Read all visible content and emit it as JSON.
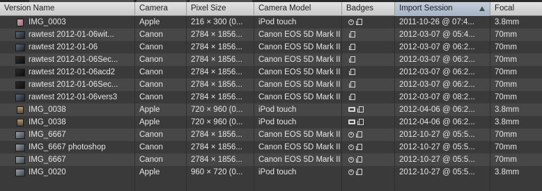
{
  "columns": [
    {
      "key": "name",
      "label": "Version Name"
    },
    {
      "key": "camera",
      "label": "Camera"
    },
    {
      "key": "pixel",
      "label": "Pixel Size"
    },
    {
      "key": "model",
      "label": "Camera Model"
    },
    {
      "key": "badges",
      "label": "Badges"
    },
    {
      "key": "session",
      "label": "Import Session",
      "sorted": "ascending"
    },
    {
      "key": "focal",
      "label": "Focal"
    }
  ],
  "rows": [
    {
      "name": "IMG_0003",
      "camera": "Apple",
      "pixel": "216 × 300 (0...",
      "model": "iPod touch",
      "badges": [
        "adjusted-icon",
        "stack-icon"
      ],
      "session": "2011-10-26 @ 07:4...",
      "focal": "3.8mm",
      "thumb": "pink"
    },
    {
      "name": "rawtest 2012-01-06wit...",
      "camera": "Canon",
      "pixel": "2784 × 1856...",
      "model": "Canon EOS 5D Mark II",
      "badges": [
        "stack-icon"
      ],
      "session": "2012-03-07 @ 05:4...",
      "focal": "70mm",
      "thumb": "dark"
    },
    {
      "name": "rawtest 2012-01-06",
      "camera": "Canon",
      "pixel": "2784 × 1856...",
      "model": "Canon EOS 5D Mark II",
      "badges": [
        "stack-icon"
      ],
      "session": "2012-03-07 @ 06:2...",
      "focal": "70mm",
      "thumb": "dark"
    },
    {
      "name": "rawtest 2012-01-06Sec...",
      "camera": "Canon",
      "pixel": "2784 × 1856...",
      "model": "Canon EOS 5D Mark II",
      "badges": [
        "stack-icon"
      ],
      "session": "2012-03-07 @ 06:2...",
      "focal": "70mm",
      "thumb": "dark2"
    },
    {
      "name": "rawtest 2012-01-06acd2",
      "camera": "Canon",
      "pixel": "2784 × 1856...",
      "model": "Canon EOS 5D Mark II",
      "badges": [
        "stack-icon"
      ],
      "session": "2012-03-07 @ 06:2...",
      "focal": "70mm",
      "thumb": "dark2"
    },
    {
      "name": "rawtest 2012-01-06Sec...",
      "camera": "Canon",
      "pixel": "2784 × 1856...",
      "model": "Canon EOS 5D Mark II",
      "badges": [
        "stack-icon"
      ],
      "session": "2012-03-07 @ 06:2...",
      "focal": "70mm",
      "thumb": "dark2"
    },
    {
      "name": "rawtest 2012-01-06vers3",
      "camera": "Canon",
      "pixel": "2784 × 1856...",
      "model": "Canon EOS 5D Mark II",
      "badges": [
        "stack-icon"
      ],
      "session": "2012-03-07 @ 08:2...",
      "focal": "70mm",
      "thumb": "dark"
    },
    {
      "name": "IMG_0038",
      "camera": "Apple",
      "pixel": "720 × 960 (0...",
      "model": "iPod touch",
      "badges": [
        "movie-icon",
        "stack-icon"
      ],
      "session": "2012-04-06 @ 06:2...",
      "focal": "3.8mm",
      "thumb": "portrait"
    },
    {
      "name": "IMG_0038",
      "camera": "Apple",
      "pixel": "720 × 960 (0...",
      "model": "iPod touch",
      "badges": [
        "movie-icon",
        "stack-icon"
      ],
      "session": "2012-04-06 @ 06:2...",
      "focal": "3.8mm",
      "thumb": "portrait"
    },
    {
      "name": "IMG_6667",
      "camera": "Canon",
      "pixel": "2784 × 1856...",
      "model": "Canon EOS 5D Mark II",
      "badges": [
        "adjusted-icon",
        "stack-icon"
      ],
      "session": "2012-10-27 @ 05:5...",
      "focal": "70mm",
      "thumb": "photo"
    },
    {
      "name": "IMG_6667 photoshop",
      "camera": "Canon",
      "pixel": "2784 × 1856...",
      "model": "Canon EOS 5D Mark II",
      "badges": [
        "adjusted-icon",
        "stack-icon"
      ],
      "session": "2012-10-27 @ 05:5...",
      "focal": "70mm",
      "thumb": "photo"
    },
    {
      "name": "IMG_6667",
      "camera": "Canon",
      "pixel": "2784 × 1856...",
      "model": "Canon EOS 5D Mark II",
      "badges": [
        "adjusted-icon",
        "stack-icon"
      ],
      "session": "2012-10-27 @ 05:5...",
      "focal": "70mm",
      "thumb": "photo"
    },
    {
      "name": "IMG_0020",
      "camera": "Apple",
      "pixel": "960 × 720 (0...",
      "model": "iPod touch",
      "badges": [
        "adjusted-icon",
        "stack-icon"
      ],
      "session": "2012-10-27 @ 05:5...",
      "focal": "3.8mm",
      "thumb": "photo"
    }
  ]
}
